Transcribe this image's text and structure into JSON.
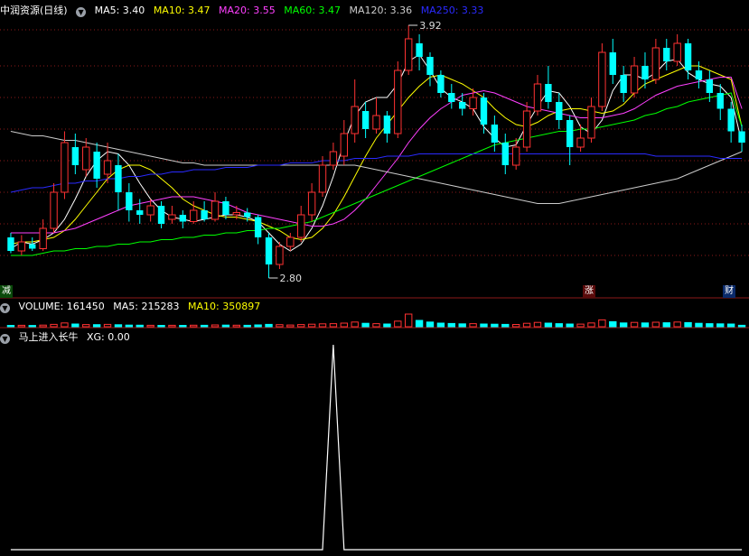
{
  "main": {
    "title": "中润资源(日线)",
    "ma": [
      {
        "label": "MA5: 3.40",
        "color": "#ffffff"
      },
      {
        "label": "MA10: 3.47",
        "color": "#ffff00"
      },
      {
        "label": "MA20: 3.55",
        "color": "#ff40ff"
      },
      {
        "label": "MA60: 3.47",
        "color": "#00ff00"
      },
      {
        "label": "MA120: 3.36",
        "color": "#cccccc"
      },
      {
        "label": "MA250: 3.33",
        "color": "#2a2aff"
      }
    ],
    "high_label": "3.92",
    "low_label": "2.80",
    "badges": {
      "left": "减",
      "mid": "涨",
      "right": "财"
    }
  },
  "volume": {
    "name": "VOLUME: 161450",
    "ma5": "MA5: 215283",
    "ma10": "MA10: 350897"
  },
  "indicator": {
    "name": "马上进入长牛",
    "xg": "XG: 0.00"
  },
  "colors": {
    "up": "#ff3232",
    "down": "#00ffff",
    "grid": "#8b1a1a"
  },
  "chart_data": [
    {
      "type": "candlestick",
      "title": "中润资源(日线)",
      "y_range": [
        2.8,
        3.92
      ],
      "series_ma": [
        {
          "name": "MA5",
          "values": [
            2.93,
            2.96,
            2.95,
            2.97,
            3.0,
            3.06,
            3.15,
            3.25,
            3.32,
            3.36,
            3.35,
            3.3,
            3.22,
            3.15,
            3.1,
            3.07,
            3.06,
            3.05,
            3.06,
            3.07,
            3.08,
            3.08,
            3.07,
            3.05,
            3.0,
            2.95,
            2.92,
            2.95,
            3.02,
            3.12,
            3.25,
            3.4,
            3.52,
            3.58,
            3.6,
            3.6,
            3.66,
            3.76,
            3.79,
            3.72,
            3.64,
            3.6,
            3.58,
            3.55,
            3.47,
            3.42,
            3.38,
            3.39,
            3.48,
            3.56,
            3.63,
            3.62,
            3.56,
            3.47,
            3.44,
            3.5,
            3.63,
            3.7,
            3.7,
            3.68,
            3.71,
            3.76,
            3.77,
            3.71,
            3.68,
            3.66,
            3.65,
            3.6,
            3.4
          ]
        },
        {
          "name": "MA10",
          "values": [
            2.95,
            2.96,
            2.96,
            2.97,
            2.98,
            3.01,
            3.06,
            3.12,
            3.18,
            3.24,
            3.28,
            3.3,
            3.3,
            3.28,
            3.24,
            3.2,
            3.15,
            3.12,
            3.1,
            3.08,
            3.07,
            3.07,
            3.06,
            3.05,
            3.03,
            3.01,
            2.98,
            2.97,
            2.98,
            3.02,
            3.08,
            3.16,
            3.25,
            3.34,
            3.42,
            3.48,
            3.54,
            3.6,
            3.65,
            3.69,
            3.7,
            3.68,
            3.66,
            3.63,
            3.6,
            3.55,
            3.51,
            3.48,
            3.47,
            3.49,
            3.52,
            3.54,
            3.55,
            3.55,
            3.54,
            3.53,
            3.54,
            3.57,
            3.62,
            3.66,
            3.68,
            3.7,
            3.72,
            3.74,
            3.74,
            3.72,
            3.7,
            3.68,
            3.47
          ]
        },
        {
          "name": "MA20",
          "values": [
            3.0,
            3.0,
            3.0,
            3.0,
            3.0,
            3.01,
            3.02,
            3.04,
            3.06,
            3.08,
            3.1,
            3.12,
            3.13,
            3.14,
            3.15,
            3.16,
            3.16,
            3.16,
            3.15,
            3.14,
            3.13,
            3.11,
            3.09,
            3.08,
            3.07,
            3.06,
            3.05,
            3.04,
            3.03,
            3.03,
            3.04,
            3.06,
            3.1,
            3.15,
            3.21,
            3.27,
            3.33,
            3.4,
            3.46,
            3.51,
            3.55,
            3.58,
            3.61,
            3.62,
            3.63,
            3.62,
            3.6,
            3.58,
            3.56,
            3.55,
            3.54,
            3.53,
            3.52,
            3.51,
            3.51,
            3.51,
            3.52,
            3.53,
            3.55,
            3.58,
            3.61,
            3.63,
            3.65,
            3.66,
            3.67,
            3.68,
            3.69,
            3.69,
            3.55
          ]
        },
        {
          "name": "MA60",
          "values": [
            2.9,
            2.9,
            2.9,
            2.91,
            2.92,
            2.92,
            2.93,
            2.93,
            2.94,
            2.94,
            2.95,
            2.95,
            2.96,
            2.96,
            2.97,
            2.97,
            2.98,
            2.98,
            2.99,
            2.99,
            3.0,
            3.0,
            3.01,
            3.01,
            3.02,
            3.02,
            3.03,
            3.04,
            3.05,
            3.07,
            3.09,
            3.11,
            3.13,
            3.15,
            3.17,
            3.19,
            3.21,
            3.23,
            3.25,
            3.27,
            3.29,
            3.31,
            3.33,
            3.35,
            3.37,
            3.39,
            3.4,
            3.41,
            3.42,
            3.43,
            3.44,
            3.45,
            3.45,
            3.46,
            3.46,
            3.47,
            3.48,
            3.49,
            3.5,
            3.52,
            3.53,
            3.55,
            3.56,
            3.58,
            3.59,
            3.6,
            3.61,
            3.62,
            3.47
          ]
        },
        {
          "name": "MA120",
          "values": [
            3.45,
            3.44,
            3.43,
            3.43,
            3.42,
            3.41,
            3.41,
            3.4,
            3.39,
            3.38,
            3.37,
            3.36,
            3.35,
            3.34,
            3.33,
            3.32,
            3.31,
            3.31,
            3.3,
            3.3,
            3.3,
            3.3,
            3.3,
            3.3,
            3.3,
            3.3,
            3.3,
            3.3,
            3.3,
            3.3,
            3.3,
            3.3,
            3.3,
            3.29,
            3.28,
            3.27,
            3.26,
            3.25,
            3.24,
            3.23,
            3.22,
            3.21,
            3.2,
            3.19,
            3.18,
            3.17,
            3.16,
            3.15,
            3.14,
            3.13,
            3.13,
            3.13,
            3.14,
            3.15,
            3.16,
            3.17,
            3.18,
            3.19,
            3.2,
            3.21,
            3.22,
            3.23,
            3.24,
            3.26,
            3.28,
            3.3,
            3.32,
            3.34,
            3.36
          ]
        },
        {
          "name": "MA250",
          "values": [
            3.18,
            3.19,
            3.2,
            3.2,
            3.21,
            3.22,
            3.22,
            3.23,
            3.23,
            3.24,
            3.24,
            3.25,
            3.25,
            3.26,
            3.26,
            3.27,
            3.27,
            3.28,
            3.28,
            3.28,
            3.29,
            3.29,
            3.29,
            3.3,
            3.3,
            3.3,
            3.31,
            3.31,
            3.31,
            3.32,
            3.32,
            3.32,
            3.33,
            3.33,
            3.33,
            3.34,
            3.34,
            3.34,
            3.35,
            3.35,
            3.35,
            3.35,
            3.35,
            3.35,
            3.35,
            3.35,
            3.35,
            3.35,
            3.35,
            3.35,
            3.35,
            3.35,
            3.35,
            3.35,
            3.35,
            3.35,
            3.35,
            3.35,
            3.35,
            3.35,
            3.34,
            3.34,
            3.34,
            3.34,
            3.34,
            3.34,
            3.33,
            3.33,
            3.33
          ]
        }
      ],
      "candles": [
        [
          2.98,
          2.92,
          3.0,
          2.91
        ],
        [
          2.92,
          2.96,
          2.99,
          2.9
        ],
        [
          2.95,
          2.93,
          2.98,
          2.92
        ],
        [
          2.93,
          3.02,
          3.06,
          2.92
        ],
        [
          3.02,
          3.18,
          3.22,
          3.0
        ],
        [
          3.18,
          3.4,
          3.45,
          3.15
        ],
        [
          3.38,
          3.3,
          3.44,
          3.26
        ],
        [
          3.28,
          3.38,
          3.42,
          3.25
        ],
        [
          3.36,
          3.24,
          3.4,
          3.2
        ],
        [
          3.26,
          3.32,
          3.4,
          3.22
        ],
        [
          3.3,
          3.18,
          3.35,
          3.1
        ],
        [
          3.18,
          3.1,
          3.22,
          3.05
        ],
        [
          3.1,
          3.08,
          3.15,
          3.04
        ],
        [
          3.08,
          3.12,
          3.15,
          3.05
        ],
        [
          3.12,
          3.04,
          3.14,
          3.02
        ],
        [
          3.06,
          3.08,
          3.12,
          3.04
        ],
        [
          3.08,
          3.05,
          3.1,
          3.02
        ],
        [
          3.05,
          3.1,
          3.14,
          3.04
        ],
        [
          3.1,
          3.06,
          3.14,
          3.05
        ],
        [
          3.06,
          3.14,
          3.18,
          3.05
        ],
        [
          3.14,
          3.08,
          3.16,
          3.06
        ],
        [
          3.08,
          3.09,
          3.12,
          3.06
        ],
        [
          3.09,
          3.07,
          3.11,
          3.05
        ],
        [
          3.07,
          2.98,
          3.08,
          2.95
        ],
        [
          2.98,
          2.86,
          3.0,
          2.8
        ],
        [
          2.86,
          2.94,
          2.96,
          2.84
        ],
        [
          2.94,
          2.98,
          3.0,
          2.92
        ],
        [
          2.98,
          3.08,
          3.12,
          2.96
        ],
        [
          3.08,
          3.18,
          3.22,
          3.05
        ],
        [
          3.18,
          3.3,
          3.34,
          3.16
        ],
        [
          3.3,
          3.36,
          3.4,
          3.28
        ],
        [
          3.34,
          3.44,
          3.5,
          3.3
        ],
        [
          3.44,
          3.56,
          3.68,
          3.4
        ],
        [
          3.54,
          3.46,
          3.58,
          3.42
        ],
        [
          3.46,
          3.52,
          3.6,
          3.44
        ],
        [
          3.52,
          3.44,
          3.54,
          3.4
        ],
        [
          3.44,
          3.72,
          3.76,
          3.42
        ],
        [
          3.72,
          3.86,
          3.92,
          3.7
        ],
        [
          3.84,
          3.78,
          3.88,
          3.72
        ],
        [
          3.78,
          3.7,
          3.8,
          3.65
        ],
        [
          3.7,
          3.62,
          3.72,
          3.6
        ],
        [
          3.62,
          3.58,
          3.66,
          3.55
        ],
        [
          3.58,
          3.55,
          3.62,
          3.52
        ],
        [
          3.55,
          3.6,
          3.64,
          3.52
        ],
        [
          3.6,
          3.48,
          3.62,
          3.44
        ],
        [
          3.48,
          3.4,
          3.52,
          3.36
        ],
        [
          3.4,
          3.3,
          3.44,
          3.26
        ],
        [
          3.3,
          3.38,
          3.42,
          3.28
        ],
        [
          3.38,
          3.54,
          3.58,
          3.36
        ],
        [
          3.54,
          3.66,
          3.7,
          3.52
        ],
        [
          3.66,
          3.58,
          3.74,
          3.55
        ],
        [
          3.58,
          3.5,
          3.62,
          3.46
        ],
        [
          3.5,
          3.38,
          3.52,
          3.3
        ],
        [
          3.38,
          3.42,
          3.48,
          3.36
        ],
        [
          3.42,
          3.56,
          3.6,
          3.4
        ],
        [
          3.56,
          3.8,
          3.84,
          3.54
        ],
        [
          3.8,
          3.7,
          3.86,
          3.66
        ],
        [
          3.7,
          3.62,
          3.74,
          3.58
        ],
        [
          3.62,
          3.74,
          3.78,
          3.6
        ],
        [
          3.74,
          3.68,
          3.8,
          3.64
        ],
        [
          3.68,
          3.82,
          3.86,
          3.66
        ],
        [
          3.82,
          3.76,
          3.86,
          3.72
        ],
        [
          3.76,
          3.84,
          3.88,
          3.74
        ],
        [
          3.84,
          3.72,
          3.86,
          3.68
        ],
        [
          3.72,
          3.68,
          3.76,
          3.64
        ],
        [
          3.68,
          3.62,
          3.72,
          3.58
        ],
        [
          3.62,
          3.55,
          3.66,
          3.5
        ],
        [
          3.55,
          3.45,
          3.58,
          3.4
        ],
        [
          3.45,
          3.4,
          3.48,
          3.36
        ]
      ]
    },
    {
      "type": "bar",
      "title": "VOLUME",
      "values": [
        150,
        160,
        140,
        180,
        260,
        420,
        300,
        240,
        230,
        260,
        220,
        180,
        170,
        160,
        150,
        160,
        150,
        170,
        160,
        200,
        180,
        170,
        160,
        200,
        260,
        230,
        190,
        240,
        280,
        320,
        340,
        400,
        520,
        380,
        340,
        300,
        620,
        1400,
        700,
        520,
        400,
        360,
        320,
        340,
        300,
        280,
        260,
        250,
        380,
        480,
        400,
        340,
        300,
        290,
        420,
        760,
        560,
        420,
        480,
        420,
        500,
        440,
        520,
        460,
        380,
        340,
        320,
        300,
        161
      ]
    },
    {
      "type": "line",
      "title": "马上进入长牛",
      "signal_index": 30,
      "signal_value": 1,
      "values_note_len": 69
    }
  ]
}
